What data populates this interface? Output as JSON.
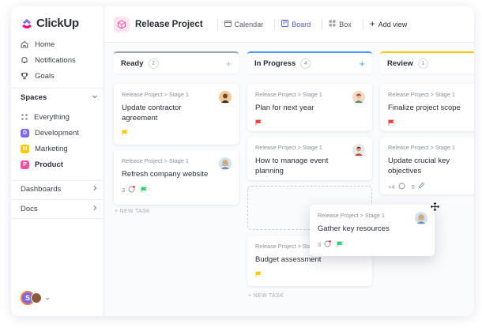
{
  "app": {
    "name": "ClickUp",
    "brand_colors": [
      "#7b68ee",
      "#ff0080",
      "#ffc800"
    ]
  },
  "sidebar": {
    "nav": [
      {
        "label": "Home",
        "icon": "home-icon"
      },
      {
        "label": "Notifications",
        "icon": "bell-icon"
      },
      {
        "label": "Goals",
        "icon": "trophy-icon"
      }
    ],
    "spaces_label": "Spaces",
    "spaces": [
      {
        "label": "Everything",
        "icon": "grid-icon"
      },
      {
        "label": "Development",
        "letter": "D",
        "color": "#7b68ee"
      },
      {
        "label": "Marketing",
        "letter": "M",
        "color": "#ffc800"
      },
      {
        "label": "Product",
        "letter": "P",
        "color": "#ff4fa3",
        "active": true
      }
    ],
    "dashboards_label": "Dashboards",
    "docs_label": "Docs",
    "user_initial": "S"
  },
  "header": {
    "project_title": "Release Project",
    "views": [
      {
        "label": "Calendar",
        "icon": "calendar-icon"
      },
      {
        "label": "Board",
        "icon": "board-icon",
        "active": true
      },
      {
        "label": "Box",
        "icon": "box-icon"
      }
    ],
    "add_view_label": "Add view"
  },
  "board": {
    "new_task_label": "+ NEW TASK",
    "columns": [
      {
        "title": "Ready",
        "count": "2",
        "accent": "#a0a4ab",
        "cards": [
          {
            "crumb": "Release Project > Stage 1",
            "title": "Update contractor agreement",
            "flag": "#ffc800"
          },
          {
            "crumb": "Release Project > Stage 1",
            "title": "Refresh company website",
            "comments": "3",
            "flag": "#2ecd6f"
          }
        ]
      },
      {
        "title": "In Progress",
        "count": "4",
        "accent": "#4d9cf8",
        "cards": [
          {
            "crumb": "Release Project > Stage 1",
            "title": "Plan for next year",
            "flag": "#f03e3e"
          },
          {
            "crumb": "Release Project > Stage 1",
            "title": "How to manage event planning"
          },
          {
            "crumb": "Release Project > Stage 1",
            "title": "Budget assessment",
            "flag": "#ffc800"
          }
        ]
      },
      {
        "title": "Review",
        "count": "1",
        "accent": "#ffc800",
        "cards": [
          {
            "crumb": "Release Project > Stage 1",
            "title": "Finalize project scope",
            "flag": "#f03e3e"
          },
          {
            "crumb": "Release Project > Stage 1",
            "title": "Update crucial key objectives",
            "extra": "+4",
            "attachments": "5"
          }
        ]
      }
    ],
    "dragging_card": {
      "crumb": "Release Project > Stage 1",
      "title": "Gather key resources",
      "comments": "3",
      "flag": "#2ecd6f"
    }
  }
}
